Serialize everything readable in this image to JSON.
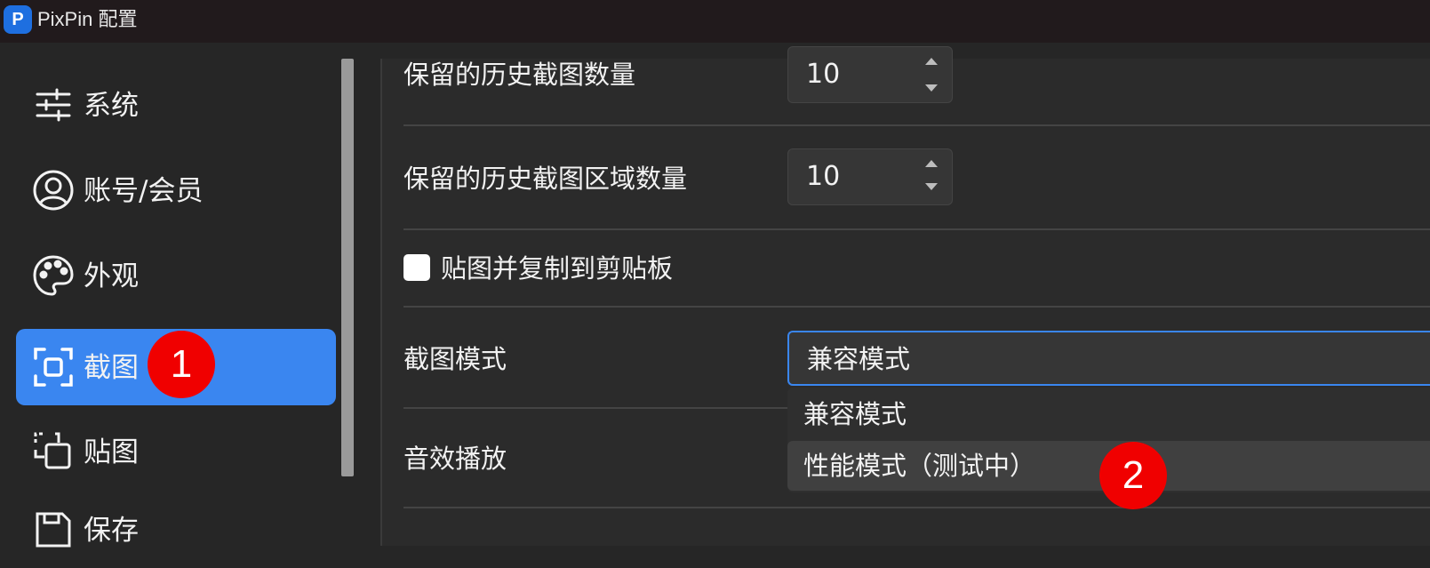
{
  "window": {
    "title": "PixPin 配置",
    "logo_letter": "P"
  },
  "sidebar": {
    "items": [
      {
        "label": "系统",
        "icon": "sliders-icon"
      },
      {
        "label": "账号/会员",
        "icon": "user-circle-icon"
      },
      {
        "label": "外观",
        "icon": "palette-icon"
      },
      {
        "label": "截图",
        "icon": "screenshot-frame-icon",
        "active": true
      },
      {
        "label": "贴图",
        "icon": "pin-image-icon"
      },
      {
        "label": "保存",
        "icon": "save-icon"
      }
    ]
  },
  "settings": {
    "history_count": {
      "label": "保留的历史截图数量",
      "value": "10"
    },
    "history_region_count": {
      "label": "保留的历史截图区域数量",
      "value": "10"
    },
    "copy_on_pin": {
      "label": "贴图并复制到剪贴板",
      "checked": false
    },
    "capture_mode": {
      "label": "截图模式",
      "selected": "兼容模式",
      "options": [
        "兼容模式",
        "性能模式（测试中）"
      ],
      "hovered_option": "性能模式（测试中）"
    },
    "sound_effect": {
      "label": "音效播放"
    }
  },
  "annotations": [
    {
      "number": "1"
    },
    {
      "number": "2"
    }
  ],
  "colors": {
    "accent": "#3a86f0",
    "badge": "#f00000",
    "background": "#262626"
  }
}
